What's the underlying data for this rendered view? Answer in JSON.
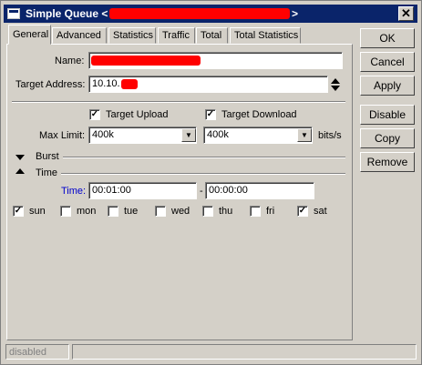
{
  "window": {
    "title": "Simple Queue <",
    "title_suffix": ">",
    "close_glyph": "✕"
  },
  "tabs": [
    "General",
    "Advanced",
    "Statistics",
    "Traffic",
    "Total",
    "Total Statistics"
  ],
  "active_tab": "General",
  "form": {
    "name_label": "Name:",
    "name_value": "",
    "target_label": "Target Address:",
    "target_value": "10.10.",
    "target_upload_label": "Target Upload",
    "target_upload_checked": true,
    "target_download_label": "Target Download",
    "target_download_checked": true,
    "max_limit_label": "Max Limit:",
    "max_limit_upload": "400k",
    "max_limit_download": "400k",
    "max_limit_unit": "bits/s",
    "burst_label": "Burst",
    "time_section_label": "Time",
    "time_label": "Time:",
    "time_start": "00:01:00",
    "time_dash": "-",
    "time_end": "00:00:00"
  },
  "days": [
    {
      "label": "sun",
      "checked": true
    },
    {
      "label": "mon",
      "checked": false
    },
    {
      "label": "tue",
      "checked": false
    },
    {
      "label": "wed",
      "checked": false
    },
    {
      "label": "thu",
      "checked": false
    },
    {
      "label": "fri",
      "checked": false
    },
    {
      "label": "sat",
      "checked": true
    }
  ],
  "buttons": {
    "ok": "OK",
    "cancel": "Cancel",
    "apply": "Apply",
    "disable": "Disable",
    "copy": "Copy",
    "remove": "Remove"
  },
  "status": {
    "state": "disabled"
  },
  "colors": {
    "titlebar": "#0a246a",
    "redaction": "#ff0000",
    "time_label": "#0000cc"
  }
}
